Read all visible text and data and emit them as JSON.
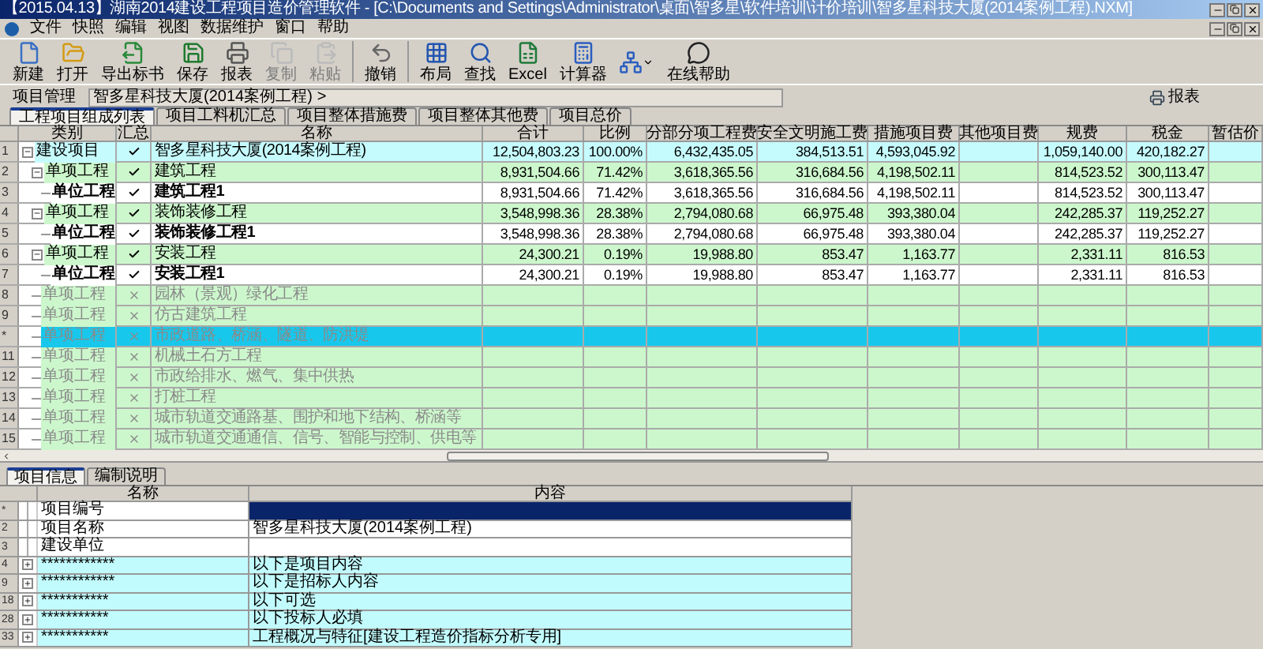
{
  "window": {
    "title": "【2015.04.13】湖南2014建设工程项目造价管理软件 - [C:\\Documents and Settings\\Administrator\\桌面\\智多星\\软件培训\\计价培训\\智多星科技大厦(2014案例工程).NXM]"
  },
  "menu": [
    "文件",
    "快照",
    "编辑",
    "视图",
    "数据维护",
    "窗口",
    "帮助"
  ],
  "toolbar": [
    {
      "kind": "new",
      "label": "新建",
      "disabled": false
    },
    {
      "kind": "open",
      "label": "打开",
      "disabled": false
    },
    {
      "kind": "export",
      "label": "导出标书",
      "disabled": false
    },
    {
      "kind": "save",
      "label": "保存",
      "disabled": false
    },
    {
      "kind": "print",
      "label": "报表",
      "disabled": false
    },
    {
      "kind": "copy",
      "label": "复制",
      "disabled": true
    },
    {
      "kind": "paste",
      "label": "粘贴",
      "disabled": true
    },
    {
      "kind": "undo",
      "label": "撤销",
      "disabled": false
    },
    {
      "kind": "layout",
      "label": "布局",
      "disabled": false
    },
    {
      "kind": "find",
      "label": "查找",
      "disabled": false
    },
    {
      "kind": "excel",
      "label": "Excel",
      "disabled": false
    },
    {
      "kind": "calc",
      "label": "计算器",
      "disabled": false
    },
    {
      "kind": "tree",
      "disabled": false
    },
    {
      "kind": "help",
      "label": "在线帮助",
      "disabled": false
    }
  ],
  "breadcrumb": {
    "root": "项目管理",
    "path": "智多星科技大厦(2014案例工程)",
    "separator": ">",
    "report_button": "报表"
  },
  "tabs": [
    {
      "label": "工程项目组成列表",
      "selected": true
    },
    {
      "label": "项目工料机汇总",
      "selected": false
    },
    {
      "label": "项目整体措施费",
      "selected": false
    },
    {
      "label": "项目整体其他费",
      "selected": false
    },
    {
      "label": "项目总价",
      "selected": false
    }
  ],
  "table": {
    "columns": [
      "类别",
      "汇总",
      "名称",
      "合计",
      "比例",
      "分部分项工程费",
      "安全文明施工费",
      "措施项目费",
      "其他项目费",
      "规费",
      "税金",
      "暂估价"
    ],
    "rows": [
      {
        "row_label": "1",
        "type": "建设项目",
        "included": true,
        "name": "智多星科技大厦(2014案例工程)",
        "total": "12,504,803.23",
        "ratio": "100.00%",
        "subitem_fee": "6,432,435.05",
        "safety_fee": "384,513.51",
        "measures_fee": "4,593,045.92",
        "fees": "1,059,140.00",
        "tax": "420,182.27",
        "selected": false,
        "disabled": false,
        "expanded": true,
        "children": [
          {
            "row_label": "2",
            "type": "单项工程",
            "included": true,
            "name": "建筑工程",
            "total": "8,931,504.66",
            "ratio": "71.42%",
            "subitem_fee": "3,618,365.56",
            "safety_fee": "316,684.56",
            "measures_fee": "4,198,502.11",
            "fees": "814,523.52",
            "tax": "300,113.47",
            "selected": false,
            "disabled": false,
            "expanded": true,
            "children": [
              {
                "row_label": "3",
                "type": "单位工程",
                "included": true,
                "name": "建筑工程1",
                "total": "8,931,504.66",
                "ratio": "71.42%",
                "subitem_fee": "3,618,365.56",
                "safety_fee": "316,684.56",
                "measures_fee": "4,198,502.11",
                "fees": "814,523.52",
                "tax": "300,113.47",
                "selected": false,
                "disabled": false
              }
            ]
          },
          {
            "row_label": "4",
            "type": "单项工程",
            "included": true,
            "name": "装饰装修工程",
            "total": "3,548,998.36",
            "ratio": "28.38%",
            "subitem_fee": "2,794,080.68",
            "safety_fee": "66,975.48",
            "measures_fee": "393,380.04",
            "fees": "242,285.37",
            "tax": "119,252.27",
            "selected": false,
            "disabled": false,
            "expanded": true,
            "children": [
              {
                "row_label": "5",
                "type": "单位工程",
                "included": true,
                "name": "装饰装修工程1",
                "total": "3,548,998.36",
                "ratio": "28.38%",
                "subitem_fee": "2,794,080.68",
                "safety_fee": "66,975.48",
                "measures_fee": "393,380.04",
                "fees": "242,285.37",
                "tax": "119,252.27",
                "selected": false,
                "disabled": false
              }
            ]
          },
          {
            "row_label": "6",
            "type": "单项工程",
            "included": true,
            "name": "安装工程",
            "total": "24,300.21",
            "ratio": "0.19%",
            "subitem_fee": "19,988.80",
            "safety_fee": "853.47",
            "measures_fee": "1,163.77",
            "fees": "2,331.11",
            "tax": "816.53",
            "selected": false,
            "disabled": false,
            "expanded": true,
            "children": [
              {
                "row_label": "7",
                "type": "单位工程",
                "included": true,
                "name": "安装工程1",
                "total": "24,300.21",
                "ratio": "0.19%",
                "subitem_fee": "19,988.80",
                "safety_fee": "853.47",
                "measures_fee": "1,163.77",
                "fees": "2,331.11",
                "tax": "816.53",
                "selected": false,
                "disabled": false
              }
            ]
          },
          {
            "row_label": "8",
            "type": "单项工程",
            "included": false,
            "name": "园林（景观）绿化工程",
            "selected": false,
            "disabled": true
          },
          {
            "row_label": "9",
            "type": "单项工程",
            "included": false,
            "name": "仿古建筑工程",
            "selected": false,
            "disabled": true
          },
          {
            "row_label": "*",
            "type": "单项工程",
            "included": false,
            "name": "市政道路、桥涵、隧道、防洪堤",
            "selected": true,
            "disabled": true
          },
          {
            "row_label": "11",
            "type": "单项工程",
            "included": false,
            "name": "机械土石方工程",
            "selected": false,
            "disabled": true
          },
          {
            "row_label": "12",
            "type": "单项工程",
            "included": false,
            "name": "市政给排水、燃气、集中供热",
            "selected": false,
            "disabled": true
          },
          {
            "row_label": "13",
            "type": "单项工程",
            "included": false,
            "name": "打桩工程",
            "selected": false,
            "disabled": true
          },
          {
            "row_label": "14",
            "type": "单项工程",
            "included": false,
            "name": "城市轨道交通路基、围护和地下结构、桥涵等",
            "selected": false,
            "disabled": true
          },
          {
            "row_label": "15",
            "type": "单项工程",
            "included": false,
            "name": "城市轨道交通通信、信号、智能与控制、供电等",
            "selected": false,
            "disabled": true
          }
        ]
      }
    ]
  },
  "info_tabs": [
    {
      "label": "项目信息",
      "selected": true
    },
    {
      "label": "编制说明",
      "selected": false
    }
  ],
  "info_table": {
    "columns": [
      "名称",
      "内容"
    ],
    "rows": [
      {
        "row_label": "*",
        "kind": "field",
        "name": "项目编号",
        "selected": true
      },
      {
        "row_label": "2",
        "kind": "field",
        "name": "项目名称",
        "content": "智多星科技大厦(2014案例工程)",
        "selected": false
      },
      {
        "row_label": "3",
        "kind": "field",
        "name": "建设单位",
        "selected": false
      },
      {
        "row_label": "4",
        "kind": "group",
        "name": "************",
        "content": "以下是项目内容",
        "expanded": false,
        "selected": false
      },
      {
        "row_label": "9",
        "kind": "group",
        "name": "************",
        "content": "以下是招标人内容",
        "expanded": false,
        "selected": false
      },
      {
        "row_label": "18",
        "kind": "group",
        "name": "***********",
        "content": "以下可选",
        "expanded": false,
        "selected": false
      },
      {
        "row_label": "28",
        "kind": "group",
        "name": "***********",
        "content": "以下投标人必填",
        "expanded": false,
        "selected": false
      },
      {
        "row_label": "33",
        "kind": "group",
        "name": "***********",
        "content": "工程概况与特征[建设工程造价指标分析专用]",
        "expanded": false,
        "selected": false
      }
    ]
  }
}
